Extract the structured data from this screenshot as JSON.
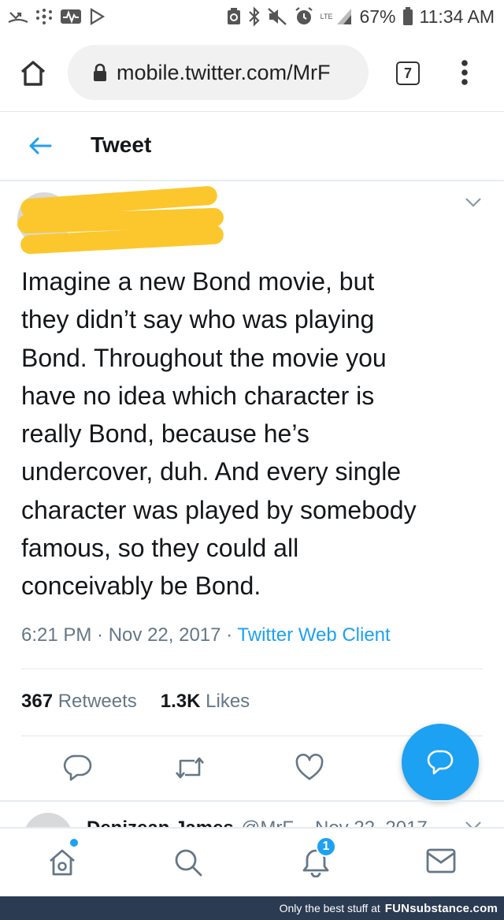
{
  "status_bar": {
    "network_label": "LTE",
    "battery": "67%",
    "time": "11:34 AM"
  },
  "browser": {
    "url": "mobile.twitter.com/MrF",
    "tab_count": "7"
  },
  "header": {
    "title": "Tweet"
  },
  "tweet": {
    "text_lines": [
      "Imagine a new Bond movie, but",
      "they didn’t say who was playing",
      "Bond. Throughout the movie you",
      "have no idea which character is",
      "really Bond, because he’s",
      "undercover, duh. And every single",
      "character was played by somebody",
      "famous, so they could all",
      "conceivably be Bond."
    ],
    "time": "6:21 PM",
    "date": "Nov 22, 2017",
    "client": "Twitter Web Client",
    "retweets_count": "367",
    "retweets_label": "Retweets",
    "likes_count": "1.3K",
    "likes_label": "Likes"
  },
  "reply_preview": {
    "name": "Denizean James",
    "handle": "@MrF",
    "date": "Nov 22, 2017"
  },
  "bottom_nav": {
    "notifications_badge": "1"
  },
  "footer": {
    "tagline": "Only the best stuff at",
    "brand": "FUNsubstance.com"
  },
  "colors": {
    "twitter_blue": "#1da1f2",
    "redaction": "#fcc72c",
    "footer_bg": "#2b3b52",
    "secondary_text": "#657786"
  }
}
